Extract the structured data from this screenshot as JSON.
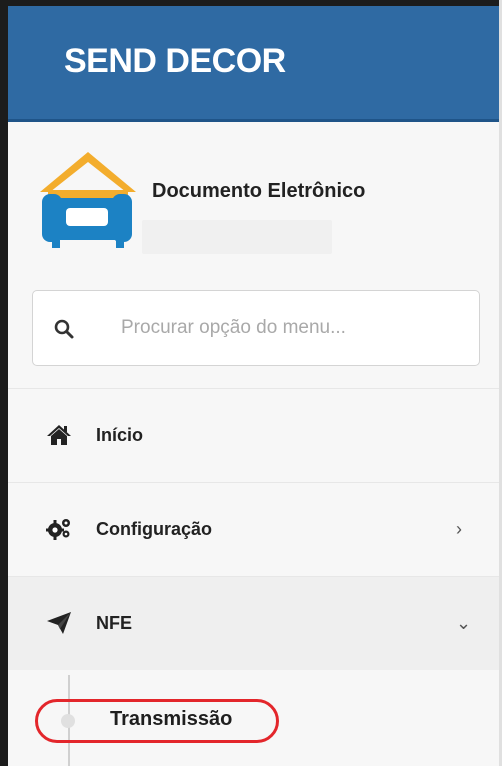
{
  "header": {
    "title": "SEND DECOR"
  },
  "company": {
    "name": "Documento Eletrônico",
    "logo_icon": "armchair-house-logo-icon"
  },
  "search": {
    "placeholder": "Procurar opção do menu...",
    "icon": "search-icon"
  },
  "menu": {
    "items": [
      {
        "label": "Início",
        "icon": "home-icon",
        "chevron": ""
      },
      {
        "label": "Configuração",
        "icon": "gears-icon",
        "chevron": "›"
      },
      {
        "label": "NFE",
        "icon": "paper-plane-icon",
        "chevron": "⌄"
      }
    ],
    "submenu": [
      {
        "label": "Transmissão",
        "highlighted": true
      }
    ]
  },
  "colors": {
    "header_bg": "#2f6aa3",
    "highlight_ring": "#e3262b",
    "logo_orange": "#f3ad2d",
    "logo_blue": "#1c82c4"
  }
}
